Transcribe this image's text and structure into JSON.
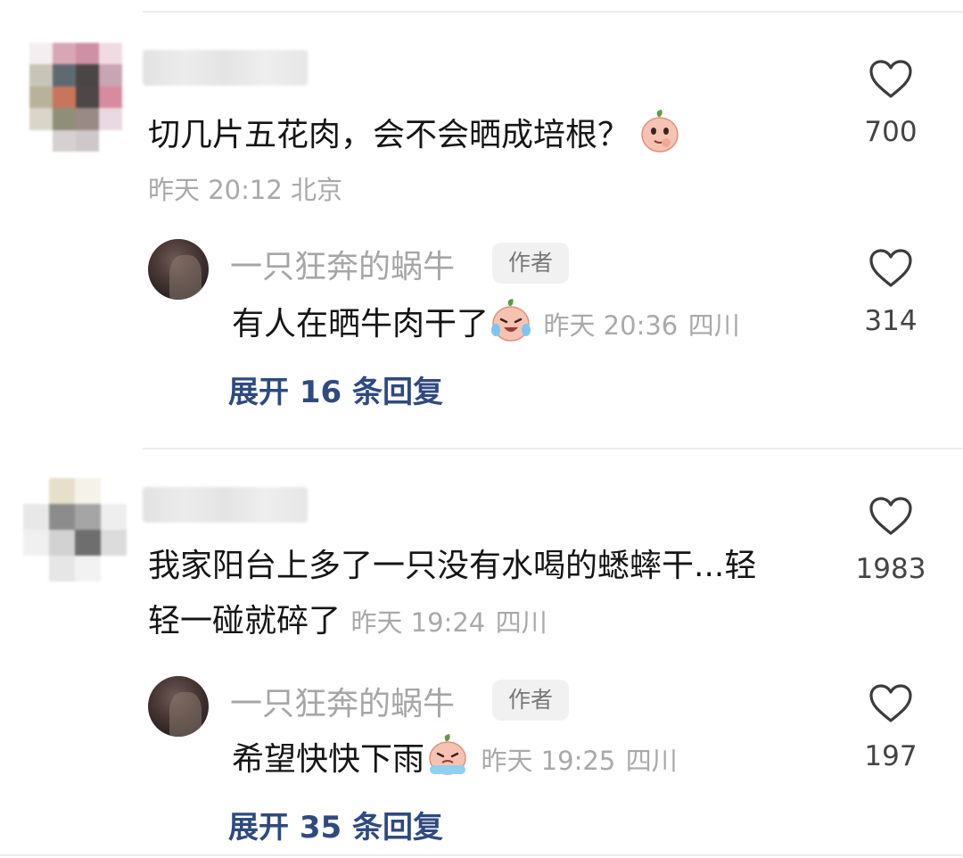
{
  "comments": [
    {
      "text": "切几片五花肉，会不会晒成培根？",
      "emoji": "peach-thinking-emoji",
      "time": "昨天 20:12",
      "location": "北京",
      "likes": "700",
      "reply": {
        "name": "一只狂奔的蜗牛",
        "badge": "作者",
        "text": "有人在晒牛肉干了",
        "emoji": "peach-crying-emoji",
        "time": "昨天 20:36",
        "location": "四川",
        "likes": "314"
      },
      "expand_label": "展开 16 条回复"
    },
    {
      "text_line1": "我家阳台上多了一只没有水喝的蟋蟀干...轻",
      "text_line2": "轻一碰就碎了",
      "time": "昨天 19:24",
      "location": "四川",
      "likes": "1983",
      "reply": {
        "name": "一只狂奔的蜗牛",
        "badge": "作者",
        "text": "希望快快下雨",
        "emoji": "peach-tearful-emoji",
        "time": "昨天 19:25",
        "location": "四川",
        "likes": "197"
      },
      "expand_label": "展开 35 条回复"
    }
  ],
  "colors": {
    "expand_link": "#2f4a80",
    "meta_gray": "#a9a9a9",
    "divider": "#ececec"
  }
}
